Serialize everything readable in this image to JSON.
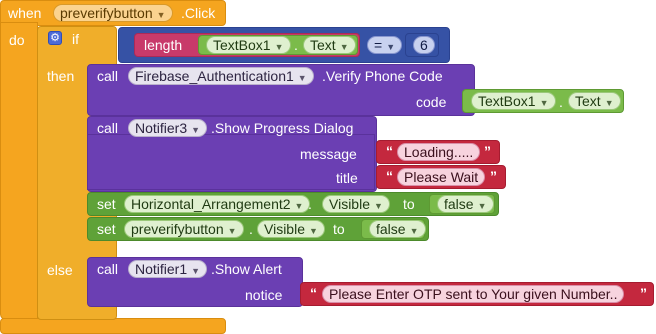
{
  "event": {
    "when": "when",
    "component": "preverifybutton",
    "event_name": ".Click",
    "do": "do"
  },
  "if_block": {
    "if": "if",
    "then": "then",
    "else": "else"
  },
  "condition": {
    "length": "length",
    "component": "TextBox1",
    "dot": ".",
    "property": "Text",
    "operator": "=",
    "value": "6"
  },
  "call_verify": {
    "call": "call",
    "component": "Firebase_Authentication1",
    "method": ".Verify Phone Code",
    "param": "code",
    "arg_component": "TextBox1",
    "dot": ".",
    "arg_property": "Text"
  },
  "call_progress": {
    "call": "call",
    "component": "Notifier3",
    "method": ".Show Progress Dialog",
    "param1": "message",
    "arg1": "Loading.....",
    "param2": "title",
    "arg2": "Please Wait"
  },
  "set_arrangement": {
    "set": "set",
    "component": "Horizontal_Arrangement2",
    "dot": ".",
    "property": "Visible",
    "to": "to",
    "value": "false"
  },
  "set_button": {
    "set": "set",
    "component": "preverifybutton",
    "dot": ".",
    "property": "Visible",
    "to": "to",
    "value": "false"
  },
  "call_alert": {
    "call": "call",
    "component": "Notifier1",
    "method": ".Show Alert",
    "param": "notice",
    "arg": "Please Enter OTP sent to Your given Number.."
  },
  "quote_open": "“",
  "quote_close": "”",
  "icons": [
    "gear-icon",
    "dropdown-arrow-icon"
  ]
}
